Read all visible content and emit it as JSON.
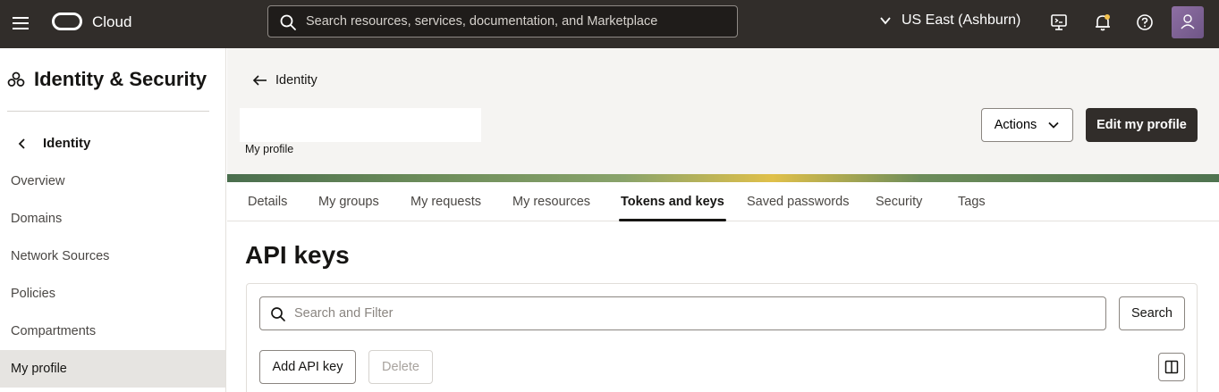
{
  "topbar": {
    "brand": "Cloud",
    "search_placeholder": "Search resources, services, documentation, and Marketplace",
    "region": "US East (Ashburn)",
    "icons": [
      "menu-icon",
      "oracle-logo",
      "search-icon",
      "chevron-down-icon",
      "cloud-shell-icon",
      "bell-icon",
      "help-icon",
      "user-avatar"
    ]
  },
  "sidebar": {
    "title": "Identity & Security",
    "back_label": "Identity",
    "items": [
      {
        "label": "Overview",
        "active": false
      },
      {
        "label": "Domains",
        "active": false
      },
      {
        "label": "Network Sources",
        "active": false
      },
      {
        "label": "Policies",
        "active": false
      },
      {
        "label": "Compartments",
        "active": false
      },
      {
        "label": "My profile",
        "active": true
      }
    ]
  },
  "header": {
    "back_label": "Identity",
    "name": "",
    "subtitle": "My profile",
    "actions_label": "Actions",
    "edit_label": "Edit my profile"
  },
  "tabs": [
    {
      "label": "Details",
      "active": false
    },
    {
      "label": "My groups",
      "active": false
    },
    {
      "label": "My requests",
      "active": false
    },
    {
      "label": "My resources",
      "active": false
    },
    {
      "label": "Tokens and keys",
      "active": true
    },
    {
      "label": "Saved passwords",
      "active": false
    },
    {
      "label": "Security",
      "active": false
    },
    {
      "label": "Tags",
      "active": false
    }
  ],
  "api_keys": {
    "title": "API keys",
    "filter_placeholder": "Search and Filter",
    "search_label": "Search",
    "add_label": "Add API key",
    "delete_label": "Delete"
  },
  "colors": {
    "topbar": "#312d2a",
    "primary_button": "#312d2a",
    "active_sidebar": "#e6e4e1",
    "header_bg": "#f5f4f2"
  }
}
